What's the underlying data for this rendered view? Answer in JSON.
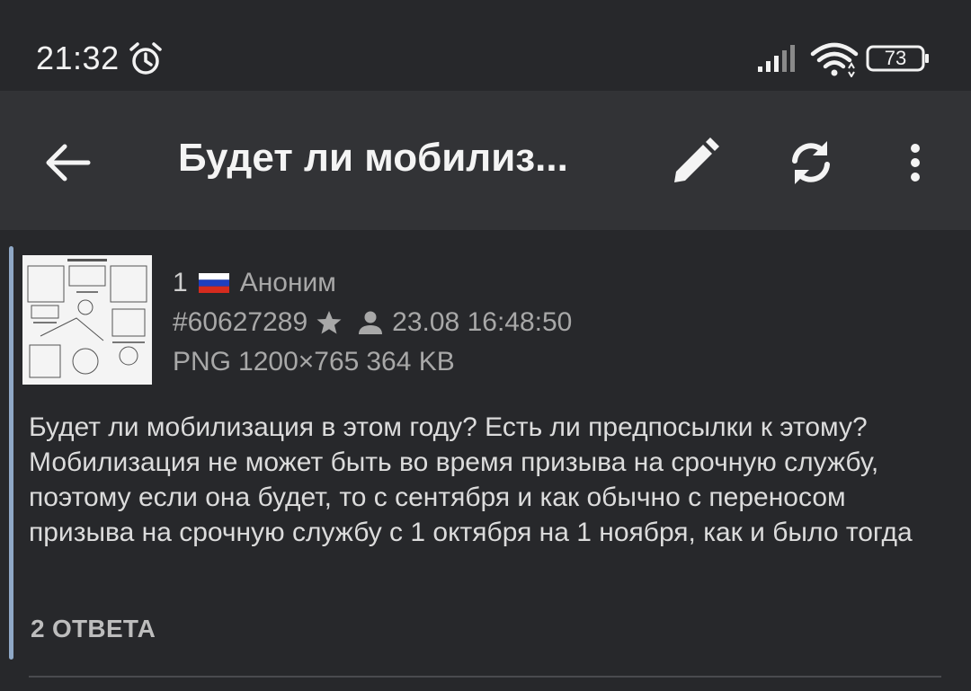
{
  "status_bar": {
    "time": "21:32",
    "battery": "73",
    "icons": [
      "alarm-icon",
      "signal-icon",
      "wifi-icon",
      "battery-icon"
    ]
  },
  "app_bar": {
    "title": "Будет ли мобилиз...",
    "icons": [
      "back-arrow-icon",
      "pencil-icon",
      "refresh-icon",
      "more-vertical-icon"
    ]
  },
  "post": {
    "number": "1",
    "flag": "russia-flag-icon",
    "author": "Аноним",
    "id": "#60627289",
    "datetime": "23.08 16:48:50",
    "file_type": "PNG",
    "file_dimensions": "1200×765",
    "file_size": "364 KB",
    "body": "Будет ли мобилизация в этом году? Есть ли предпосылки к этому? Мобилизация не может быть во время призыва на срочную службу, поэтому если она будет, то с сентября и как обычно с переносом призыва на срочную службу с 1 октября на 1 ноября, как и было тогда",
    "replies_label": "2 ОТВЕТА",
    "accent_color": "#8fa8c6"
  }
}
